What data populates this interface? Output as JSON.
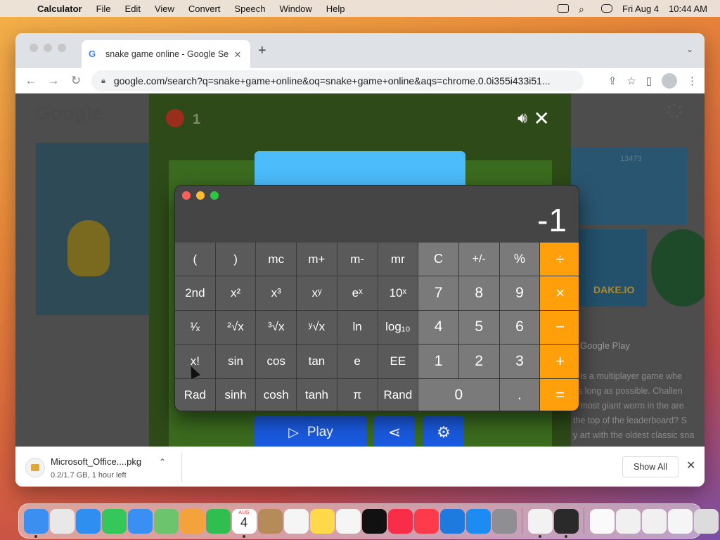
{
  "menubar": {
    "app_name": "Calculator",
    "menus": [
      "File",
      "Edit",
      "View",
      "Convert",
      "Speech",
      "Window",
      "Help"
    ],
    "date": "Fri Aug 4",
    "time": "10:44 AM"
  },
  "browser": {
    "tab_title": "snake game online - Google Se",
    "url": "google.com/search?q=snake+game+online&oq=snake+game+online&aqs=chrome.0.0i355i433i51..."
  },
  "page": {
    "logo": "Google",
    "snake_score": "1",
    "image_score": "13473",
    "image_label": "DAKE.IO",
    "google_play": "Google Play",
    "snippet_lines": [
      "e is a multiplayer game whe",
      "as long as possible. Challen",
      "e most giant worm in the are",
      "the top of the leaderboard? S",
      "y art with the oldest classic sna"
    ],
    "play_label": "Play"
  },
  "downloads": {
    "filename": "Microsoft_Office....pkg",
    "meta": "0.2/1.7 GB, 1 hour left",
    "show_all": "Show All"
  },
  "calculator": {
    "display": "-1",
    "keys": [
      [
        "(",
        ")",
        "mc",
        "m+",
        "m-",
        "mr",
        "C",
        "+/-",
        "%",
        "÷"
      ],
      [
        "2nd",
        "x²",
        "x³",
        "xʸ",
        "eˣ",
        "10ˣ",
        "7",
        "8",
        "9",
        "×"
      ],
      [
        "¹⁄ₓ",
        "²√x",
        "³√x",
        "ʸ√x",
        "ln",
        "log₁₀",
        "4",
        "5",
        "6",
        "−"
      ],
      [
        "x!",
        "sin",
        "cos",
        "tan",
        "e",
        "EE",
        "1",
        "2",
        "3",
        "+"
      ],
      [
        "Rad",
        "sinh",
        "cosh",
        "tanh",
        "π",
        "Rand",
        "0",
        ".",
        "="
      ]
    ]
  },
  "dock": {
    "apps": [
      {
        "icon": "finder-icon",
        "color": "#3b8ff0"
      },
      {
        "icon": "launchpad-icon",
        "color": "#e8e8e8"
      },
      {
        "icon": "safari-icon",
        "color": "#2f8ff0"
      },
      {
        "icon": "messages-icon",
        "color": "#34c759"
      },
      {
        "icon": "mail-icon",
        "color": "#3a8ff5"
      },
      {
        "icon": "maps-icon",
        "color": "#6cc46c"
      },
      {
        "icon": "photos-icon",
        "color": "#f4a23c"
      },
      {
        "icon": "facetime-icon",
        "color": "#2fbe4f"
      },
      {
        "icon": "calendar-icon",
        "color": "#ffffff"
      },
      {
        "icon": "contacts-icon",
        "color": "#b58b5a"
      },
      {
        "icon": "reminders-icon",
        "color": "#f5f5f5"
      },
      {
        "icon": "notes-icon",
        "color": "#ffd94a"
      },
      {
        "icon": "freeform-icon",
        "color": "#f5f5f5"
      },
      {
        "icon": "tv-icon",
        "color": "#111111"
      },
      {
        "icon": "music-icon",
        "color": "#fa2d48"
      },
      {
        "icon": "news-icon",
        "color": "#ff3b4b"
      },
      {
        "icon": "keynote-icon",
        "color": "#1f7ae0"
      },
      {
        "icon": "app-store-icon",
        "color": "#1c8cf2"
      },
      {
        "icon": "system-settings-icon",
        "color": "#8e8e93"
      },
      {
        "icon": "chrome-icon",
        "color": "#f2f2f2"
      },
      {
        "icon": "calculator-icon",
        "color": "#2a2a2a"
      },
      {
        "icon": "document-icon",
        "color": "#fafafa"
      },
      {
        "icon": "folder-preview-icon",
        "color": "#f0f0f0"
      },
      {
        "icon": "screenshot-icon",
        "color": "#f0f0f0"
      },
      {
        "icon": "window-preview-icon",
        "color": "#f5f5f5"
      },
      {
        "icon": "trash-icon",
        "color": "#dcdcdc"
      }
    ],
    "calendar_day": "4",
    "calendar_month": "AUG"
  }
}
